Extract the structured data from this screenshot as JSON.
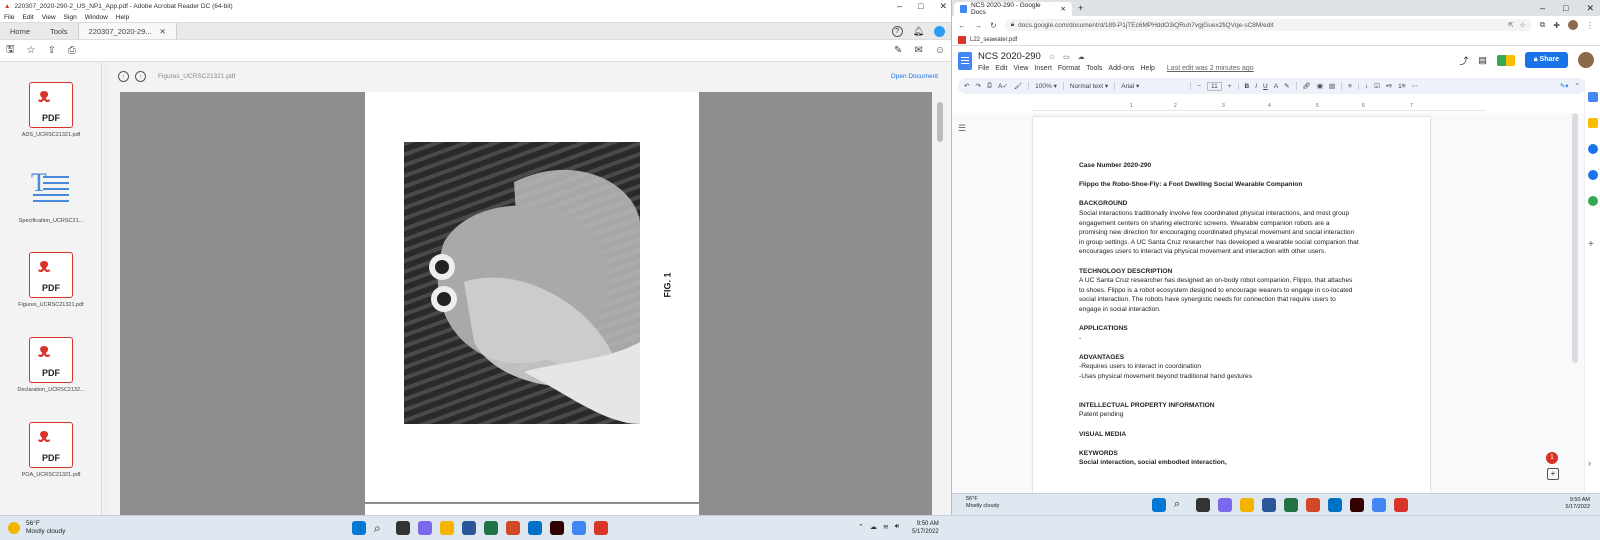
{
  "acrobat": {
    "title": "220307_2020-290-2_US_NP1_App.pdf - Adobe Acrobat Reader DC (64-bit)",
    "menu": [
      "File",
      "Edit",
      "View",
      "Sign",
      "Window",
      "Help"
    ],
    "tabs": {
      "home": "Home",
      "tools": "Tools",
      "doc": "220307_2020-29..."
    },
    "doc_toolbar_filename": "Figures_UCRSC21321.pdf",
    "open_document": "Open Document",
    "pdf_label": "PDF",
    "figure_label": "FIG. 1",
    "attachments": [
      {
        "name": "ADS_UCRSC21321.pdf",
        "kind": "pdf"
      },
      {
        "name": "Specification_UCRSC21...",
        "kind": "text"
      },
      {
        "name": "Figures_UCRSC21321.pdf",
        "kind": "pdf"
      },
      {
        "name": "Declaration_UCRSC2132...",
        "kind": "pdf"
      },
      {
        "name": "POA_UCRSC21321.pdf",
        "kind": "pdf"
      }
    ]
  },
  "chrome": {
    "tab_title": "NCS 2020-290 - Google Docs",
    "url": "docs.google.com/document/d/189-P1jTEc6MPHddO3iQRuh7vgjGuex2fiQVqe-sC8M/edit",
    "bookmark": "L22_seawater.pdf"
  },
  "docs": {
    "title": "NCS 2020-290",
    "menu": [
      "File",
      "Edit",
      "View",
      "Insert",
      "Format",
      "Tools",
      "Add-ons",
      "Help"
    ],
    "last_edit": "Last edit was 2 minutes ago",
    "share": "Share",
    "toolbar": {
      "zoom": "100%",
      "style": "Normal text",
      "font": "Arial",
      "size": "11"
    },
    "ruler": [
      "1",
      "2",
      "3",
      "4",
      "5",
      "6",
      "7"
    ],
    "content": {
      "case_number": "Case Number 2020-290",
      "title": "Flippo the Robo-Shoe-Fly: a Foot Dwelling Social Wearable Companion",
      "background_h": "BACKGROUND",
      "background_l1": "Social interactions traditionally involve few coordinated physical interactions, and most group",
      "background_l2": "engagement centers on sharing electronic screens. Wearable companion robots are a",
      "background_l3": "promising new direction for encouraging coordinated physical movement and social interaction",
      "background_l4": "in group settings. A UC Santa Cruz researcher has developed a wearable social companion that",
      "background_l5": "encourages users to interact via physical movement and interaction with other users.",
      "tech_h": "TECHNOLOGY DESCRIPTION",
      "tech_l1": "A UC Santa Cruz researcher has designed an on-body robot companion, Flippo, that attaches",
      "tech_l2": "to shoes. Flippo is a robot ecosystem designed to encourage wearers to engage in co-located",
      "tech_l3": "social interaction. The robots have synergistic needs for connection that require users to",
      "tech_l4": "engage in social interaction.",
      "applications_h": "APPLICATIONS",
      "applications_body": "-",
      "advantages_h": "ADVANTAGES",
      "adv_1": "-Requires users to interact in coordination",
      "adv_2": "-Uses physical movement beyond traditional hand gestures",
      "ip_h": "INTELLECTUAL PROPERTY INFORMATION",
      "ip_body": "Patent pending",
      "visual_h": "VISUAL MEDIA",
      "keywords_h": "KEYWORDS",
      "keywords_body": "Social interaction, social embodied interaction,"
    },
    "notification_count": "1"
  },
  "taskbar": {
    "temperature": "56°F",
    "weather": "Mostly cloudy",
    "time": "9:50 AM",
    "date": "5/17/2022"
  }
}
